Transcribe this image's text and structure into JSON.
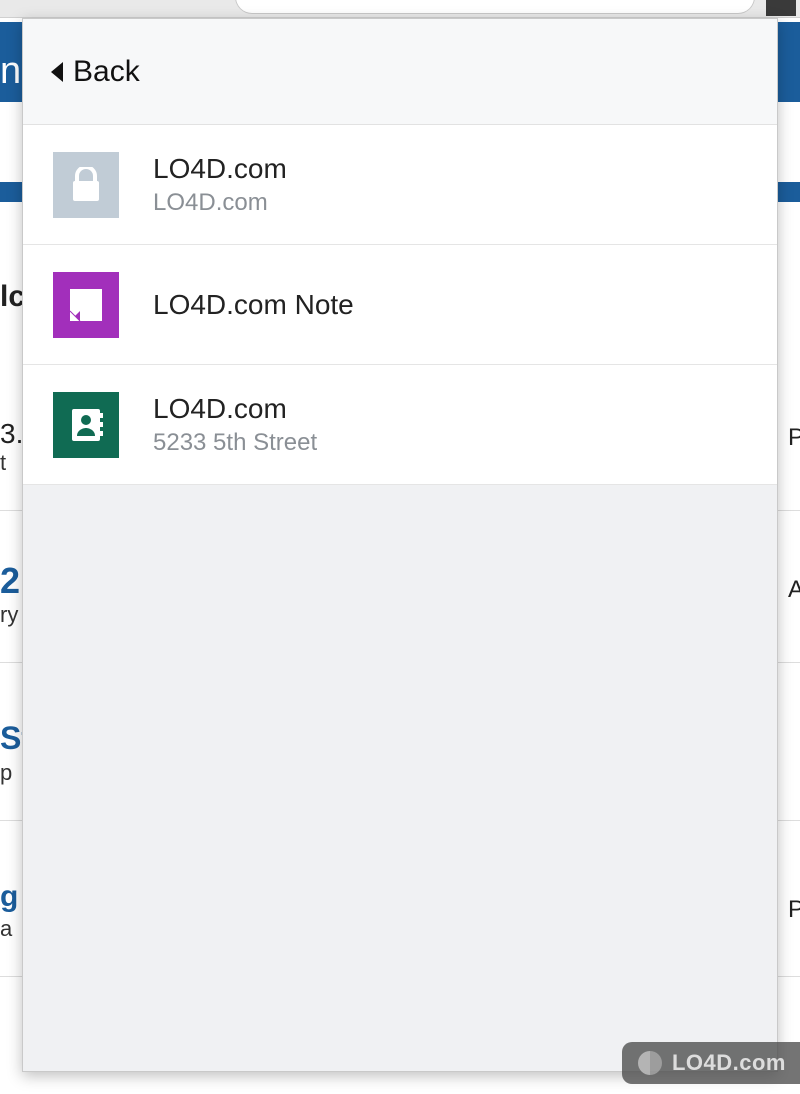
{
  "header": {
    "back_label": "Back"
  },
  "items": [
    {
      "kind": "login",
      "title": "LO4D.com",
      "subtitle": "LO4D.com",
      "icon_name": "lock-icon",
      "icon_bg": "#c1ccd6"
    },
    {
      "kind": "note",
      "title": "LO4D.com Note",
      "subtitle": "",
      "icon_name": "note-icon",
      "icon_bg": "#a22fbb"
    },
    {
      "kind": "contact",
      "title": "LO4D.com",
      "subtitle": "5233 5th Street",
      "icon_name": "contact-icon",
      "icon_bg": "#106b53"
    }
  ],
  "watermark": {
    "text": "LO4D.com"
  },
  "background": {
    "frag_n": "n",
    "frag_lc": "lc",
    "frag_3": "3.",
    "frag_t": "  t",
    "frag_2": "2",
    "frag_ry": "ry",
    "frag_St": "St",
    "frag_p": "p",
    "frag_g": "g",
    "frag_a": "a",
    "frag_Ph1": "Ph",
    "frag_A": "A",
    "frag_Ph2": "Ph"
  }
}
